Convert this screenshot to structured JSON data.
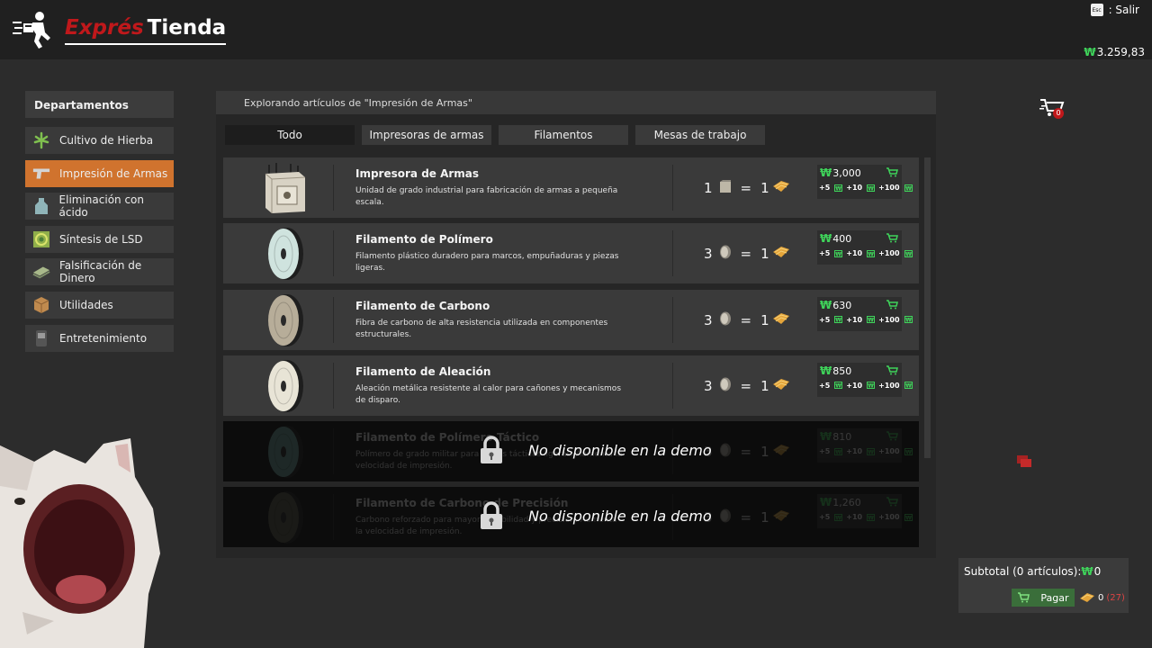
{
  "header": {
    "brand": "Exprés",
    "title": "Tienda",
    "exit_key": "Esc",
    "exit_label": ": Salir",
    "balance": "3.259,83"
  },
  "sidebar": {
    "title": "Departamentos",
    "items": [
      {
        "label": "Cultivo de Hierba",
        "icon": "weed-leaf-icon"
      },
      {
        "label": "Impresión de Armas",
        "icon": "pistol-icon",
        "active": true
      },
      {
        "label": "Eliminación con ácido",
        "icon": "acid-jug-icon"
      },
      {
        "label": "Síntesis de LSD",
        "icon": "lsd-tab-icon"
      },
      {
        "label": "Falsificación de Dinero",
        "icon": "cash-stack-icon"
      },
      {
        "label": "Utilidades",
        "icon": "box-icon"
      },
      {
        "label": "Entretenimiento",
        "icon": "arcade-icon"
      }
    ]
  },
  "main": {
    "title": "Explorando artículos de \"Impresión de Armas\"",
    "tabs": [
      {
        "label": "Todo",
        "active": true
      },
      {
        "label": "Impresoras de armas"
      },
      {
        "label": "Filamentos"
      },
      {
        "label": "Mesas de trabajo"
      }
    ],
    "products": [
      {
        "name": "Impresora de Armas",
        "desc": "Unidad de grado industrial para fabricación de armas a pequeña escala.",
        "in_qty": "1",
        "out_qty": "1",
        "price": "3,000",
        "locked": false,
        "icon": "printer-icon"
      },
      {
        "name": "Filamento de Polímero",
        "desc": "Filamento plástico duradero para marcos, empuñaduras y piezas ligeras.",
        "in_qty": "3",
        "out_qty": "1",
        "price": "400",
        "locked": false,
        "icon": "filament-spool-icon",
        "color": "#cfe3de"
      },
      {
        "name": "Filamento de Carbono",
        "desc": "Fibra de carbono de alta resistencia utilizada en componentes estructurales.",
        "in_qty": "3",
        "out_qty": "1",
        "price": "630",
        "locked": false,
        "icon": "filament-spool-icon",
        "color": "#b7ad99"
      },
      {
        "name": "Filamento de Aleación",
        "desc": "Aleación metálica resistente al calor para cañones y mecanismos de disparo.",
        "in_qty": "3",
        "out_qty": "1",
        "price": "850",
        "locked": false,
        "icon": "filament-spool-icon",
        "color": "#e8e4d6"
      },
      {
        "name": "Filamento de Polímero Táctico",
        "desc": "Polímero de grado militar para armas tácticas ligeras. Aumenta la velocidad de impresión.",
        "in_qty": "3",
        "out_qty": "1",
        "price": "810",
        "locked": true,
        "icon": "filament-spool-icon",
        "color": "#6fa8a0"
      },
      {
        "name": "Filamento de Carbono de Precisión",
        "desc": "Carbono reforzado para mayor durabilidad y precisión. Aumenta la velocidad de impresión.",
        "in_qty": "3",
        "out_qty": "1",
        "price": "1,260",
        "locked": true,
        "icon": "filament-spool-icon",
        "color": "#5a5a48"
      }
    ],
    "qty_buttons": [
      "+5",
      "+10",
      "+100"
    ],
    "equals": "=",
    "locked_text": "No disponible en la demo"
  },
  "cart": {
    "badge": "0",
    "subtotal_label": "Subtotal (0 artículos):",
    "subtotal_value": "0",
    "pay_label": "Pagar",
    "items_count": "0",
    "items_capacity": "(27)"
  },
  "colors": {
    "accent": "#d0732e",
    "money": "#3fd35a",
    "brand_red": "#c0181b",
    "pay_green": "#3a6e3a"
  }
}
